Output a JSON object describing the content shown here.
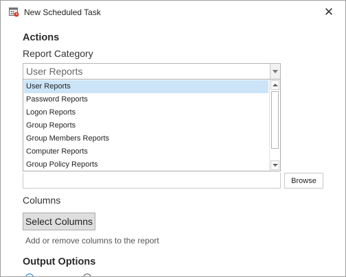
{
  "window": {
    "title": "New Scheduled Task",
    "close_glyph": "✕"
  },
  "actions": {
    "heading": "Actions",
    "category_label": "Report Category",
    "category_value": "User Reports",
    "options": [
      "User Reports",
      "Password Reports",
      "Logon Reports",
      "Group Reports",
      "Group Members Reports",
      "Computer Reports",
      "Group Policy Reports"
    ],
    "selected_index": 0,
    "browse_label": "Browse"
  },
  "columns": {
    "label": "Columns",
    "button_label": "Select Columns",
    "hint": "Add or remove columns to the report"
  },
  "output": {
    "heading": "Output Options"
  },
  "icons": {
    "title_icon": "calendar-clock-icon",
    "close_icon": "close-icon"
  },
  "colors": {
    "selection": "#cce4f7",
    "border": "#9e9e9e",
    "button_face": "#dedede"
  }
}
